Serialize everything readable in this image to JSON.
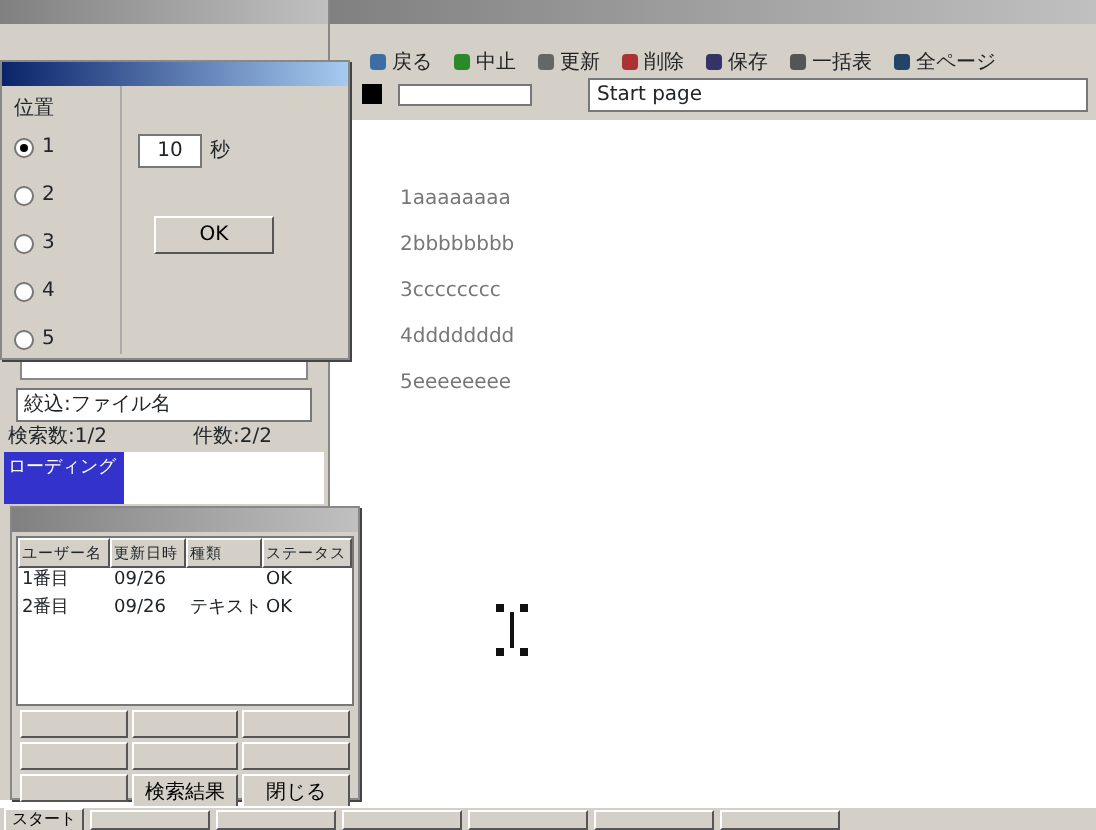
{
  "toolbar": {
    "buttons": [
      {
        "label": "戻る"
      },
      {
        "label": "中止"
      },
      {
        "label": "更新"
      },
      {
        "label": "削除"
      },
      {
        "label": "保存"
      },
      {
        "label": "一括表"
      },
      {
        "label": "全ページ"
      }
    ],
    "address": "Start page"
  },
  "document": {
    "lines": [
      "1aaaaaaaa",
      "2bbbbbbbb",
      "3cccccccc",
      "4dddddddd",
      "5eeeeeeee"
    ]
  },
  "dialog": {
    "group": "位置",
    "options": [
      {
        "label": "1",
        "selected": true
      },
      {
        "label": "2",
        "selected": false
      },
      {
        "label": "3",
        "selected": false
      },
      {
        "label": "4",
        "selected": false
      },
      {
        "label": "5",
        "selected": false
      }
    ],
    "interval_value": "10",
    "unit": "秒",
    "button": "OK"
  },
  "side_panel": {
    "filter": "絞込:ファイル名",
    "status_left": "検索数:1/2",
    "status_right": "件数:2/2",
    "items": [
      {
        "label": "ローディング",
        "selected": true
      }
    ]
  },
  "list_window": {
    "columns": [
      "ユーザー名",
      "更新日時",
      "種類",
      "ステータス"
    ],
    "rows": [
      [
        "1番目",
        "09/26",
        "",
        "OK"
      ],
      [
        "2番目",
        "09/26",
        "テキスト",
        "OK"
      ]
    ],
    "buttons": [
      {
        "label": "検索結果"
      },
      {
        "label": "閉じる"
      }
    ]
  },
  "taskbar": {
    "start": "スタート"
  }
}
